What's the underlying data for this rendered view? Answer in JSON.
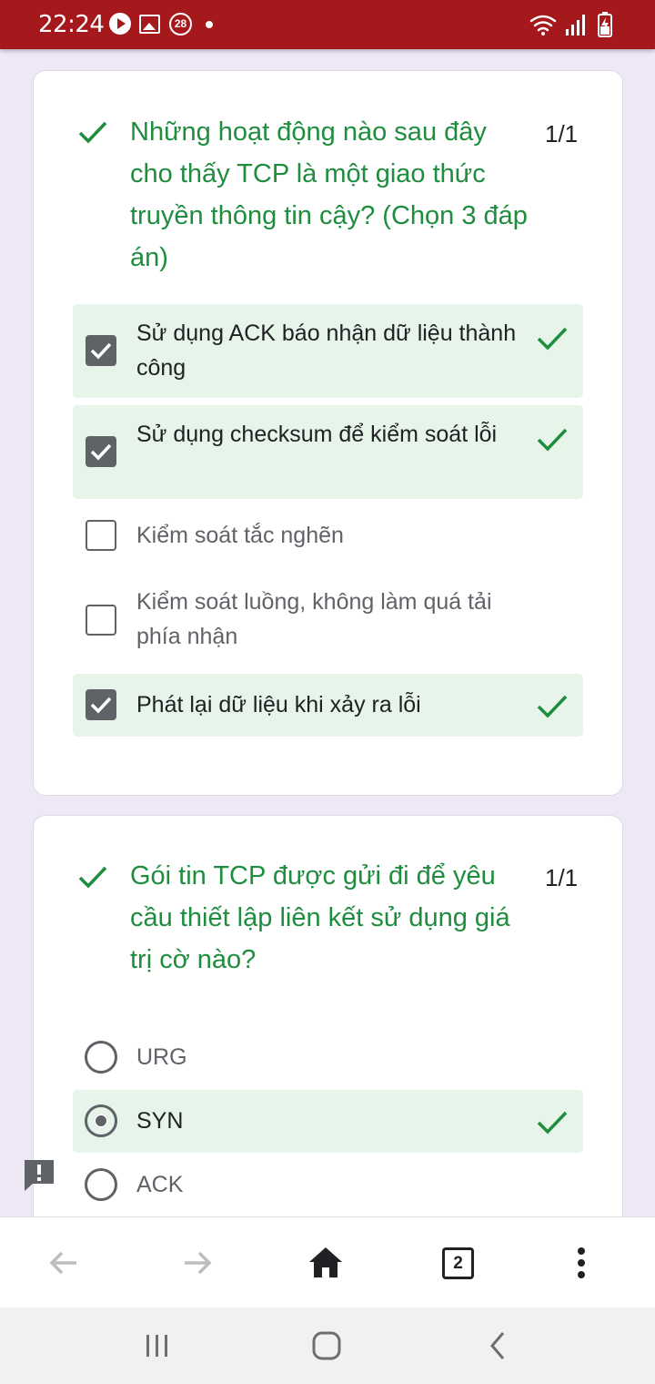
{
  "status_bar": {
    "time": "22:24",
    "notification_count": "28",
    "icons": [
      "play-icon",
      "image-icon",
      "notification-badge",
      "dot-icon",
      "wifi-icon",
      "signal-icon",
      "battery-icon"
    ]
  },
  "questions": [
    {
      "text": "Những hoạt động nào sau đây cho thấy TCP là một giao thức truyền thông tin cậy? (Chọn 3 đáp án)",
      "score": "1/1",
      "type": "checkbox",
      "options": [
        {
          "label": "Sử dụng ACK báo nhận dữ liệu thành công",
          "checked": true,
          "correct": true
        },
        {
          "label": "Sử dụng checksum để kiểm soát lỗi",
          "checked": true,
          "correct": true
        },
        {
          "label": "Kiểm soát tắc nghẽn",
          "checked": false,
          "correct": false
        },
        {
          "label": "Kiểm soát luồng, không làm quá tải phía nhận",
          "checked": false,
          "correct": false
        },
        {
          "label": "Phát lại dữ liệu khi xảy ra lỗi",
          "checked": true,
          "correct": true
        }
      ]
    },
    {
      "text": "Gói tin TCP được gửi đi để yêu cầu thiết lập liên kết sử dụng giá trị cờ nào?",
      "score": "1/1",
      "type": "radio",
      "options": [
        {
          "label": "URG",
          "checked": false,
          "correct": false
        },
        {
          "label": "SYN",
          "checked": true,
          "correct": true
        },
        {
          "label": "ACK",
          "checked": false,
          "correct": false
        }
      ]
    }
  ],
  "browser_toolbar": {
    "tab_count": "2",
    "icons": [
      "back-arrow-icon",
      "forward-arrow-icon",
      "home-icon",
      "tab-switcher",
      "more-menu-icon"
    ]
  },
  "colors": {
    "status_bar": "#a5181b",
    "correct_green": "#1e8e3e",
    "correct_bg": "#e6f4ea",
    "page_bg": "#ede7f6"
  }
}
